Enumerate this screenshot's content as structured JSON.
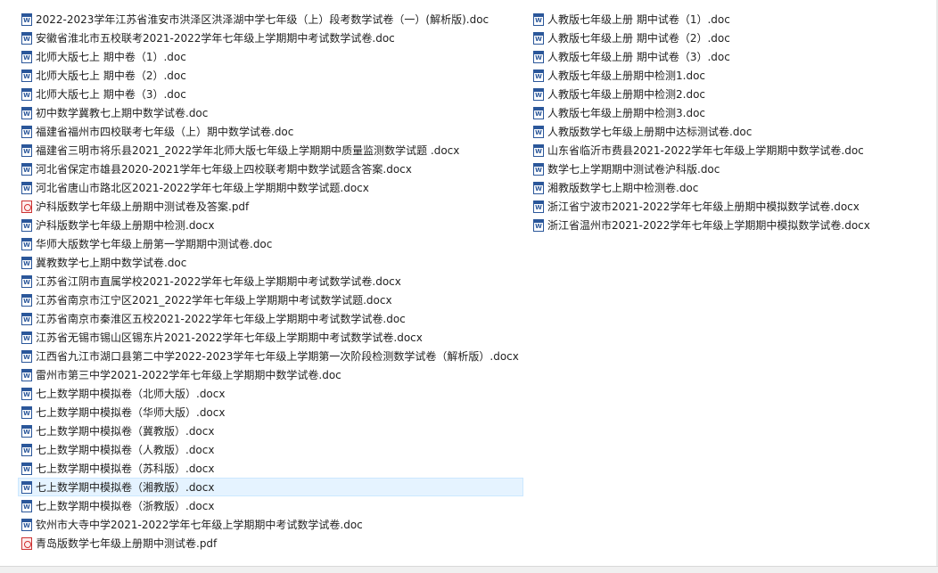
{
  "files_left": [
    {
      "name": "2022-2023学年江苏省淮安市洪泽区洪泽湖中学七年级（上）段考数学试卷（一）(解析版).doc",
      "type": "word"
    },
    {
      "name": "安徽省淮北市五校联考2021-2022学年七年级上学期期中考试数学试卷.doc",
      "type": "word"
    },
    {
      "name": "北师大版七上 期中卷（1）.doc",
      "type": "word"
    },
    {
      "name": "北师大版七上 期中卷（2）.doc",
      "type": "word"
    },
    {
      "name": "北师大版七上 期中卷（3）.doc",
      "type": "word"
    },
    {
      "name": "初中数学冀教七上期中数学试卷.doc",
      "type": "word"
    },
    {
      "name": "福建省福州市四校联考七年级（上）期中数学试卷.doc",
      "type": "word"
    },
    {
      "name": "福建省三明市将乐县2021_2022学年北师大版七年级上学期期中质量监测数学试题 .docx",
      "type": "word"
    },
    {
      "name": "河北省保定市雄县2020-2021学年七年级上四校联考期中数学试题含答案.docx",
      "type": "word"
    },
    {
      "name": "河北省唐山市路北区2021-2022学年七年级上学期期中数学试题.docx",
      "type": "word"
    },
    {
      "name": "沪科版数学七年级上册期中测试卷及答案.pdf",
      "type": "pdf"
    },
    {
      "name": "沪科版数学七年级上册期中检测.docx",
      "type": "word"
    },
    {
      "name": "华师大版数学七年级上册第一学期期中测试卷.doc",
      "type": "word"
    },
    {
      "name": "冀教数学七上期中数学试卷.doc",
      "type": "word"
    },
    {
      "name": "江苏省江阴市直属学校2021-2022学年七年级上学期期中考试数学试卷.docx",
      "type": "word"
    },
    {
      "name": "江苏省南京市江宁区2021_2022学年七年级上学期期中考试数学试题.docx",
      "type": "word"
    },
    {
      "name": "江苏省南京市秦淮区五校2021-2022学年七年级上学期期中考试数学试卷.doc",
      "type": "word"
    },
    {
      "name": "江苏省无锡市锡山区锡东片2021-2022学年七年级上学期期中考试数学试卷.docx",
      "type": "word"
    },
    {
      "name": "江西省九江市湖口县第二中学2022-2023学年七年级上学期第一次阶段检测数学试卷（解析版）.docx",
      "type": "word"
    },
    {
      "name": "雷州市第三中学2021-2022学年七年级上学期期中数学试卷.doc",
      "type": "word"
    },
    {
      "name": "七上数学期中模拟卷（北师大版）.docx",
      "type": "word"
    },
    {
      "name": "七上数学期中模拟卷（华师大版）.docx",
      "type": "word"
    },
    {
      "name": "七上数学期中模拟卷（冀教版）.docx",
      "type": "word"
    },
    {
      "name": "七上数学期中模拟卷（人教版）.docx",
      "type": "word"
    },
    {
      "name": "七上数学期中模拟卷（苏科版）.docx",
      "type": "word"
    },
    {
      "name": "七上数学期中模拟卷（湘教版）.docx",
      "type": "word",
      "selected": true
    },
    {
      "name": "七上数学期中模拟卷（浙教版）.docx",
      "type": "word"
    },
    {
      "name": "钦州市大寺中学2021-2022学年七年级上学期期中考试数学试卷.doc",
      "type": "word"
    },
    {
      "name": "青岛版数学七年级上册期中测试卷.pdf",
      "type": "pdf"
    }
  ],
  "files_right": [
    {
      "name": "人教版七年级上册 期中试卷（1）.doc",
      "type": "word"
    },
    {
      "name": "人教版七年级上册 期中试卷（2）.doc",
      "type": "word"
    },
    {
      "name": "人教版七年级上册 期中试卷（3）.doc",
      "type": "word"
    },
    {
      "name": "人教版七年级上册期中检测1.doc",
      "type": "word"
    },
    {
      "name": "人教版七年级上册期中检测2.doc",
      "type": "word"
    },
    {
      "name": "人教版七年级上册期中检测3.doc",
      "type": "word"
    },
    {
      "name": "人教版数学七年级上册期中达标测试卷.doc",
      "type": "word"
    },
    {
      "name": "山东省临沂市费县2021-2022学年七年级上学期期中数学试卷.doc",
      "type": "word"
    },
    {
      "name": "数学七上学期期中测试卷沪科版.doc",
      "type": "word"
    },
    {
      "name": "湘教版数学七上期中检测卷.doc",
      "type": "word"
    },
    {
      "name": "浙江省宁波市2021-2022学年七年级上册期中模拟数学试卷.docx",
      "type": "word"
    },
    {
      "name": "浙江省温州市2021-2022学年七年级上学期期中模拟数学试卷.docx",
      "type": "word"
    }
  ]
}
